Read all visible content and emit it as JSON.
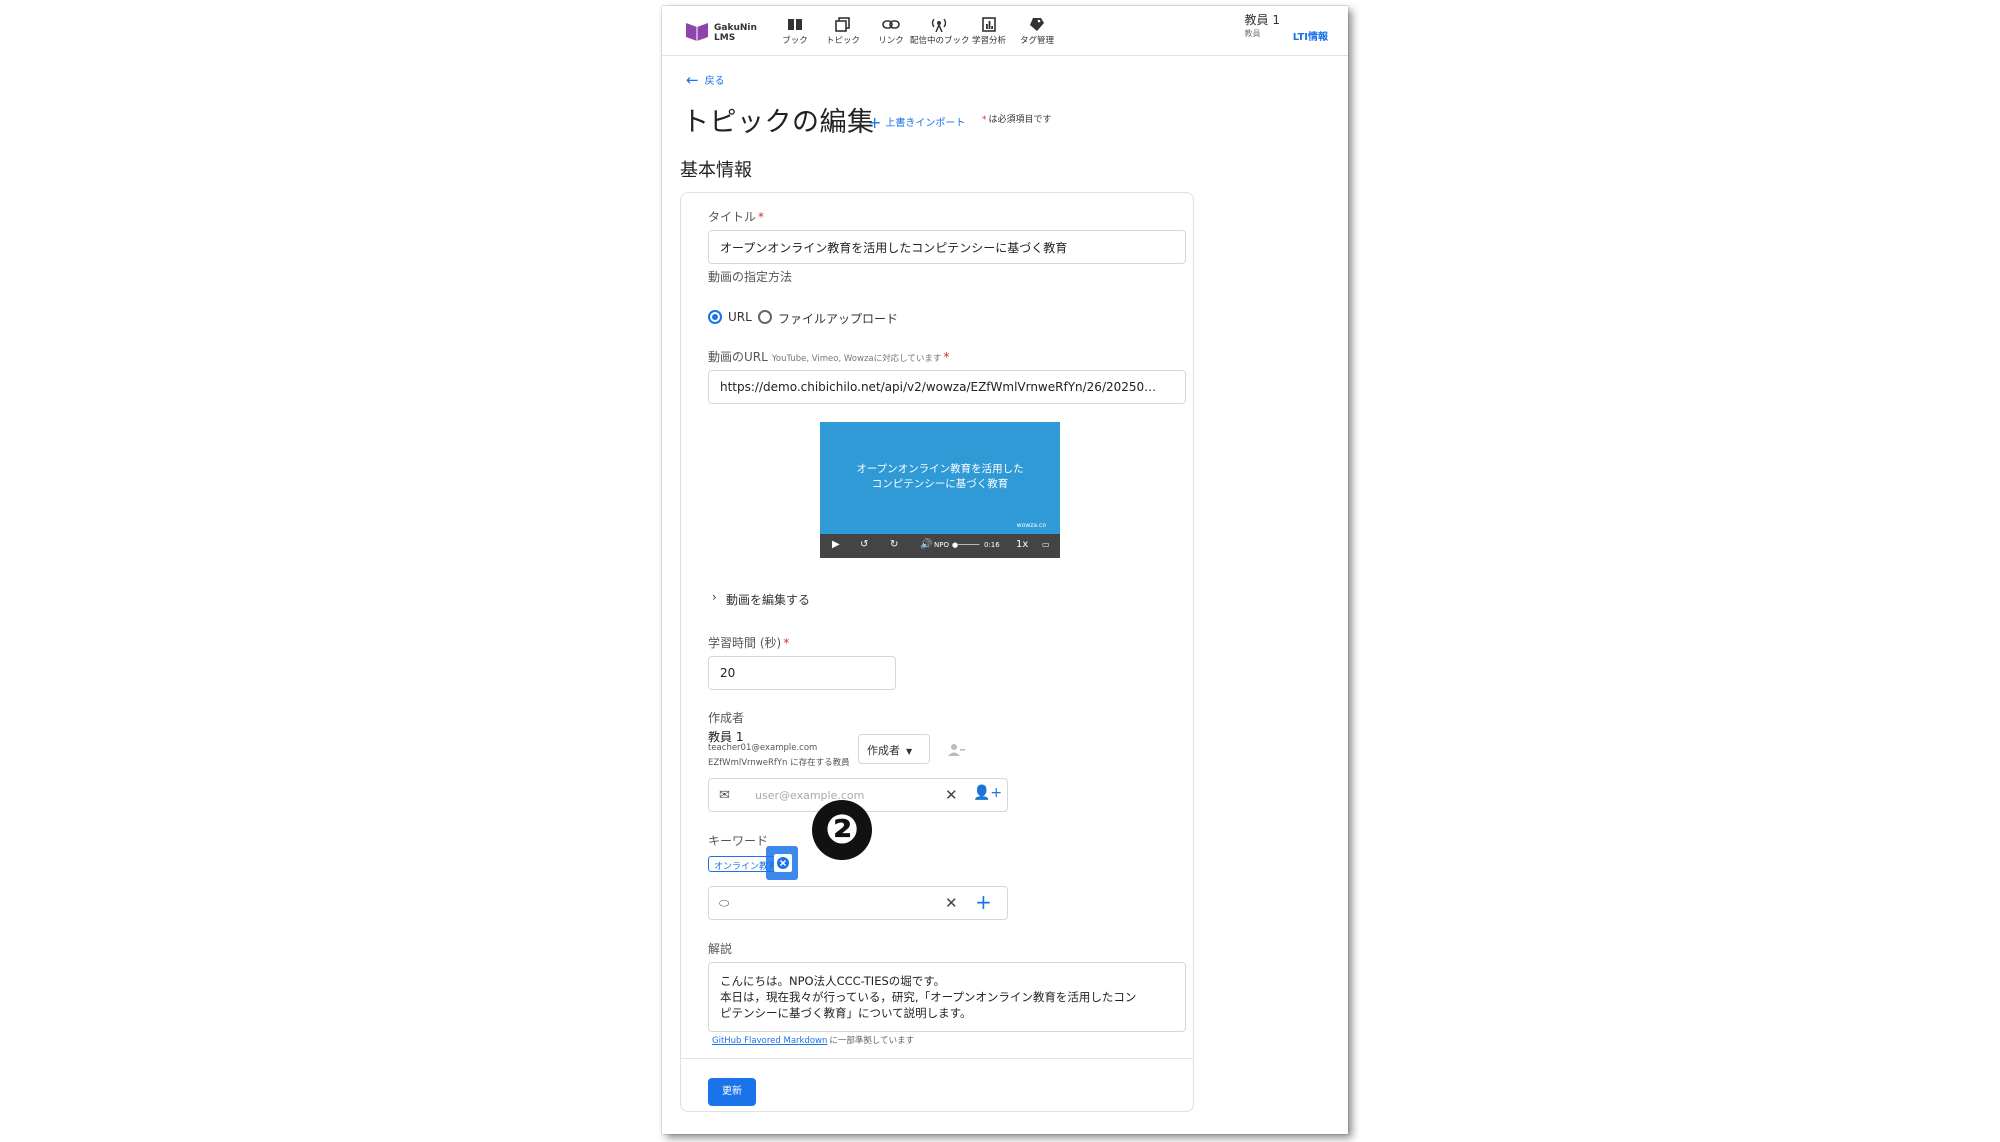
{
  "app": {
    "logo_line1": "GakuNin",
    "logo_line2": "LMS",
    "brand_color": "#8e44ad",
    "accent": "#1a73e8"
  },
  "nav": [
    {
      "icon": "book-icon",
      "label": "ブック"
    },
    {
      "icon": "topic-icon",
      "label": "トピック"
    },
    {
      "icon": "link-icon",
      "label": "リンク"
    },
    {
      "icon": "broadcast-icon",
      "label": "配信中のブック"
    },
    {
      "icon": "analytics-icon",
      "label": "学習分析"
    },
    {
      "icon": "tag-icon",
      "label": "タグ管理"
    }
  ],
  "user": {
    "name": "教員 1",
    "role": "教員",
    "lti": "LTI情報"
  },
  "back": "戻る",
  "page_title": "トピックの編集",
  "import_label": "上書きインポート",
  "required_note": "は必須項目です",
  "section_title": "基本情報",
  "form": {
    "title_label": "タイトル",
    "title_value": "オープンオンライン教育を活用したコンピテンシーに基づく教育",
    "video_method_label": "動画の指定方法",
    "radio_url": "URL",
    "radio_upload": "ファイルアップロード",
    "video_url_label": "動画のURL",
    "video_url_hint": "YouTube, Vimeo, Wowzaに対応しています",
    "video_url_value": "https://demo.chibichilo.net/api/v2/wowza/EZfWmlVrnweRfYn/26/20250…",
    "video_caption_1": "オープンオンライン教育を活用した",
    "video_caption_2": "コンピテンシーに基づく教育",
    "video_small": "wowza.co",
    "video_time": "0:16",
    "video_speed": "1x",
    "video_cc": "NPO",
    "edit_video": "動画を編集する",
    "duration_label": "学習時間 (秒)",
    "duration_value": "20",
    "author_label": "作成者",
    "author_name": "教員 1",
    "author_email": "teacher01@example.com",
    "author_org": "EZfWmlVrnweRfYn に存在する教員",
    "author_role": "作成者",
    "email_placeholder": "user@example.com",
    "keyword_label": "キーワード",
    "keyword_chip": "オンライン教育",
    "description_label": "解説",
    "description_line1": "こんにちは。NPO法人CCC-TIESの堀です。",
    "description_line2": "本日は，現在我々が行っている，研究,「オープンオンライン教育を活用したコン",
    "description_line3": "ピテンシーに基づく教育」について説明します。",
    "markdown_link": "GitHub Flavored Markdown",
    "markdown_note": "に一部準拠しています",
    "update_button": "更新"
  },
  "callout_badge": "❷"
}
